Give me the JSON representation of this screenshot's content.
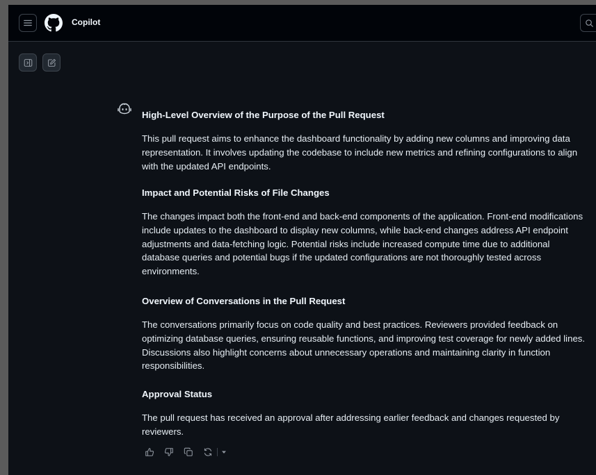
{
  "header": {
    "title": "Copilot"
  },
  "response": {
    "sections": [
      {
        "heading": "High-Level Overview of the Purpose of the Pull Request",
        "body": "This pull request aims to enhance the dashboard functionality by adding new columns and improving data representation. It involves updating the codebase to include new metrics and refining configurations to align with the updated API endpoints."
      },
      {
        "heading": "Impact and Potential Risks of File Changes",
        "body": "The changes impact both the front-end and back-end components of the application. Front-end modifications include updates to the dashboard to display new columns, while back-end changes address API endpoint adjustments and data-fetching logic. Potential risks include increased compute time due to additional database queries and potential bugs if the updated configurations are not thoroughly tested across environments."
      },
      {
        "heading": "Overview of Conversations in the Pull Request",
        "body": "The conversations primarily focus on code quality and best practices. Reviewers provided feedback on optimizing database queries, ensuring reusable functions, and improving test coverage for newly added lines. Discussions also highlight concerns about unnecessary operations and maintaining clarity in function responsibilities."
      },
      {
        "heading": "Approval Status",
        "body": "The pull request has received an approval after addressing earlier feedback and changes requested by reviewers."
      }
    ]
  },
  "icons": {
    "menu": "hamburger-icon",
    "logo": "github-logo",
    "search": "search-icon",
    "sidebar": "sidebar-toggle-icon",
    "new_chat": "new-chat-icon",
    "assistant": "copilot-icon",
    "actions": [
      "thumbs-up-icon",
      "thumbs-down-icon",
      "copy-icon",
      "retry-icon",
      "caret-down-icon"
    ]
  },
  "colors": {
    "background": "#0d1117",
    "header": "#010409",
    "text": "#e6edf3",
    "muted": "#9198a1",
    "border": "#3d444d"
  }
}
